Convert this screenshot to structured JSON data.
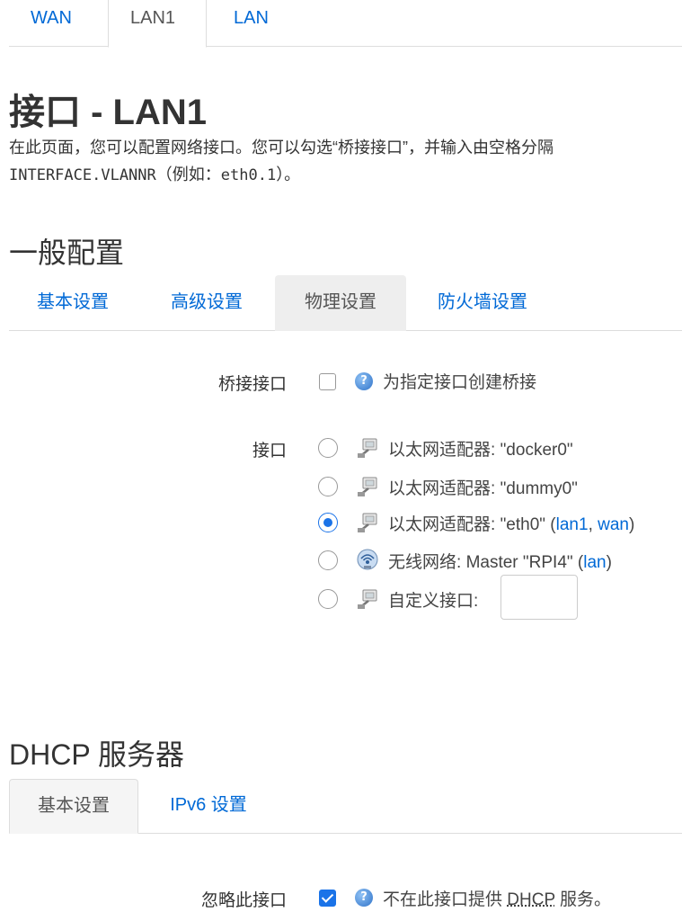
{
  "top_tabs": [
    {
      "label": "WAN"
    },
    {
      "label": "LAN1"
    },
    {
      "label": "LAN"
    }
  ],
  "page": {
    "title": "接口 - LAN1",
    "desc_line1": "在此页面，您可以配置网络接口。您可以勾选“桥接接口”，并输入由空格分隔",
    "desc_mono": "INTERFACE.VLANNR",
    "desc_line2_rest": "（例如：",
    "desc_example": "eth0.1",
    "desc_end": "）。"
  },
  "general": {
    "title": "一般配置",
    "tabs": [
      {
        "label": "基本设置"
      },
      {
        "label": "高级设置"
      },
      {
        "label": "物理设置"
      },
      {
        "label": "防火墙设置"
      }
    ],
    "bridge": {
      "label": "桥接接口",
      "checked": false,
      "help_text": "为指定接口创建桥接"
    },
    "interface": {
      "label": "接口",
      "options": [
        {
          "prefix": "以太网适配器:",
          "name": "\"docker0\"",
          "links": [],
          "checked": false,
          "icon": "ethernet-icon"
        },
        {
          "prefix": "以太网适配器:",
          "name": "\"dummy0\"",
          "links": [],
          "checked": false,
          "icon": "ethernet-icon"
        },
        {
          "prefix": "以太网适配器:",
          "name": "\"eth0\"",
          "links": [
            "lan1",
            "wan"
          ],
          "checked": true,
          "icon": "ethernet-icon"
        },
        {
          "prefix": "无线网络:",
          "name": "Master \"RPI4\"",
          "links": [
            "lan"
          ],
          "checked": false,
          "icon": "wifi-icon"
        },
        {
          "prefix": "自定义接口:",
          "name": "",
          "links": [],
          "checked": false,
          "icon": "ethernet-icon"
        }
      ],
      "custom_value": ""
    }
  },
  "dhcp": {
    "title": "DHCP 服务器",
    "tabs": [
      {
        "label": "基本设置"
      },
      {
        "label": "IPv6 设置"
      }
    ],
    "ignore": {
      "label": "忽略此接口",
      "checked": true,
      "help_pre": "不在此接口提供 ",
      "help_abbr": "DHCP",
      "help_post": " 服务。"
    }
  },
  "colors": {
    "link": "#0069d6",
    "accent": "#1a73e8"
  }
}
